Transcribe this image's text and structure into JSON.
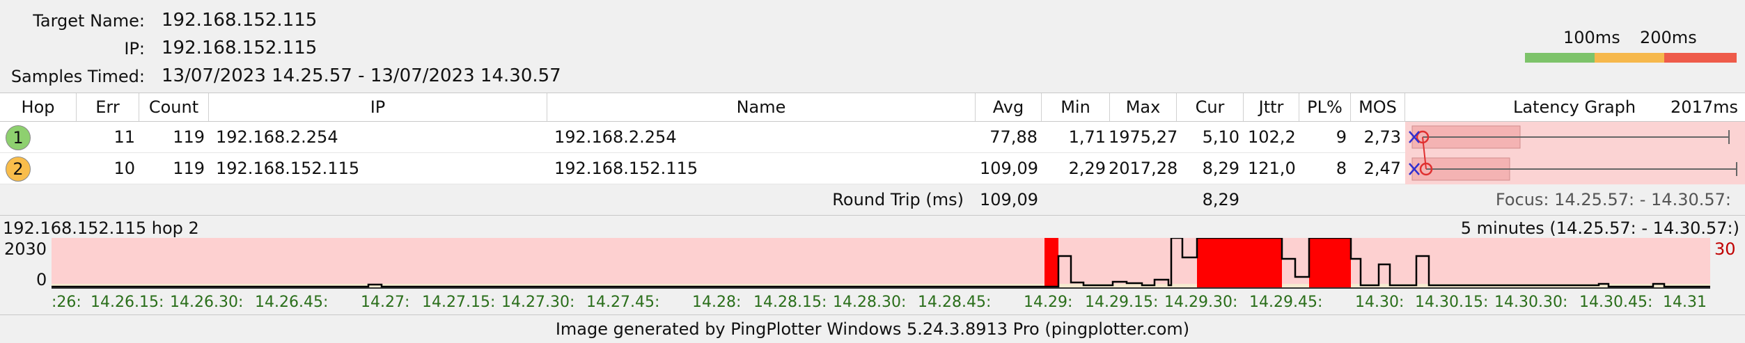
{
  "info": {
    "target_label": "Target Name:",
    "target_value": "192.168.152.115",
    "ip_label": "IP:",
    "ip_value": "192.168.152.115",
    "samples_label": "Samples Timed:",
    "samples_value": "13/07/2023 14.25.57 - 13/07/2023 14.30.57"
  },
  "scale": {
    "label_100": "100ms",
    "label_200": "200ms",
    "colors": [
      "#7dc36a",
      "#f6b84c",
      "#ee5b4a"
    ]
  },
  "columns": {
    "hop": "Hop",
    "err": "Err",
    "count": "Count",
    "ip": "IP",
    "name": "Name",
    "avg": "Avg",
    "min": "Min",
    "max": "Max",
    "cur": "Cur",
    "jttr": "Jttr",
    "pl": "PL%",
    "mos": "MOS",
    "latency": "Latency Graph",
    "latency_max": "2017ms"
  },
  "hops": [
    {
      "hop": "1",
      "err": "11",
      "count": "119",
      "ip": "192.168.2.254",
      "name": "192.168.2.254",
      "avg": "77,88",
      "min": "1,71",
      "max": "1975,27",
      "cur": "5,10",
      "jttr": "102,2",
      "pl": "9",
      "mos": "2,73",
      "color": "#8ed06f"
    },
    {
      "hop": "2",
      "err": "10",
      "count": "119",
      "ip": "192.168.152.115",
      "name": "192.168.152.115",
      "avg": "109,09",
      "min": "2,29",
      "max": "2017,28",
      "cur": "8,29",
      "jttr": "121,0",
      "pl": "8",
      "mos": "2,47",
      "color": "#f9bd4b"
    }
  ],
  "round_trip": {
    "label": "Round Trip (ms)",
    "avg": "109,09",
    "cur": "8,29",
    "focus": "Focus: 14.25.57: - 14.30.57:"
  },
  "timeline": {
    "title": "192.168.152.115 hop 2",
    "range": "5 minutes (14.25.57: - 14.30.57:)",
    "y_max": "2030",
    "y_min": "0",
    "right_value": "30",
    "ticks": [
      ":26:",
      "14.26.15:",
      "14.26.30:",
      "14.26.45:",
      "14.27:",
      "14.27.15:",
      "14.27.30:",
      "14.27.45:",
      "14.28:",
      "14.28.15:",
      "14.28.30:",
      "14.28.45:",
      "14.29:",
      "14.29.15:",
      "14.29.30:",
      "14.29.45:",
      "14.30:",
      "14.30.15:",
      "14.30.30:",
      "14.30.45:",
      "14.31"
    ]
  },
  "footer": "Image generated by PingPlotter Windows 5.24.3.8913 Pro (pingplotter.com)"
}
